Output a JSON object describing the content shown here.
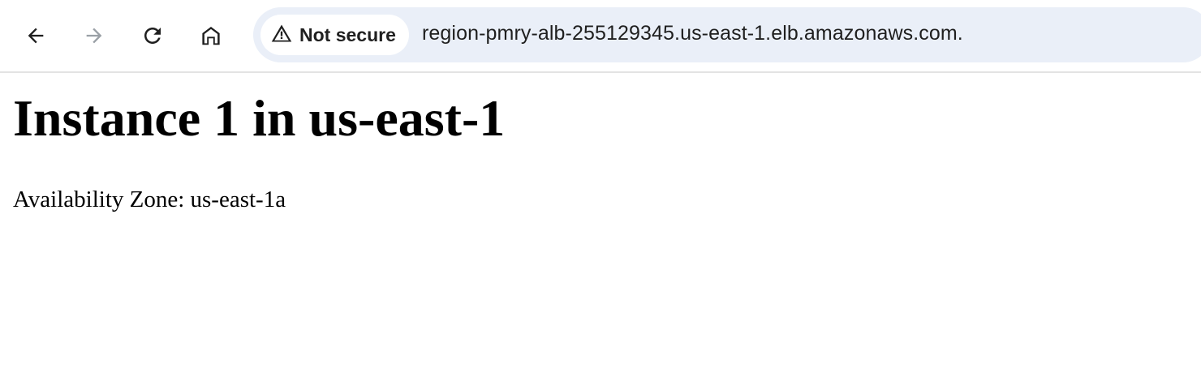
{
  "browser": {
    "security_label": "Not secure",
    "url": "region-pmry-alb-255129345.us-east-1.elb.amazonaws.com.",
    "icons": {
      "back": "arrow-left-icon",
      "forward": "arrow-right-icon",
      "reload": "reload-icon",
      "home": "home-icon",
      "security": "warning-triangle-icon"
    },
    "colors": {
      "omnibox_bg": "#eaeff8",
      "forward_disabled": "#9aa0a6",
      "icon": "#1f1f1f"
    }
  },
  "page": {
    "heading": "Instance 1 in us-east-1",
    "availability_zone": "Availability Zone: us-east-1a"
  }
}
